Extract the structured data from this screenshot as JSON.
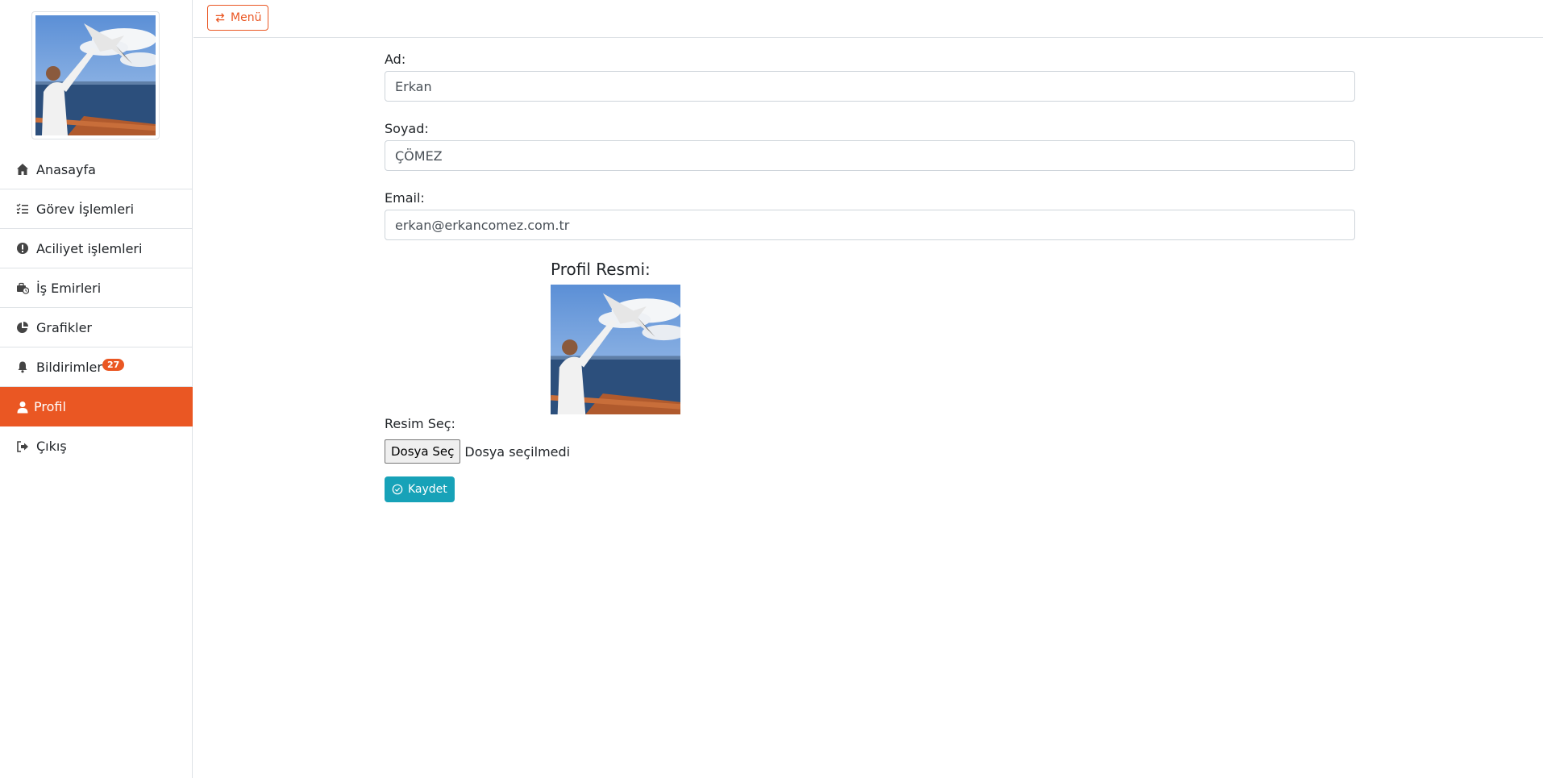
{
  "sidebar": {
    "avatar_alt": "profile photo",
    "items": [
      {
        "label": "Anasayfa",
        "icon": "home-icon"
      },
      {
        "label": "Görev İşlemleri",
        "icon": "task-list-icon"
      },
      {
        "label": "Aciliyet işlemleri",
        "icon": "exclamation-circle-icon"
      },
      {
        "label": "İş Emirleri",
        "icon": "briefcase-clock-icon"
      },
      {
        "label": "Grafikler",
        "icon": "pie-chart-icon"
      },
      {
        "label": "Bildirimler",
        "icon": "bell-icon",
        "badge": "27"
      },
      {
        "label": "Profil",
        "icon": "user-icon",
        "active": true
      },
      {
        "label": "Çıkış",
        "icon": "sign-out-icon"
      }
    ]
  },
  "topbar": {
    "menu_label": "Menü",
    "menu_icon": "exchange-arrows-icon"
  },
  "form": {
    "first_name_label": "Ad:",
    "first_name_value": "Erkan",
    "last_name_label": "Soyad:",
    "last_name_value": "ÇÖMEZ",
    "email_label": "Email:",
    "email_value": "erkan@erkancomez.com.tr",
    "profile_picture_label": "Profil Resmi:",
    "choose_image_label": "Resim Seç:",
    "file_button_label": "Dosya Seç",
    "file_status": "Dosya seçilmedi",
    "save_label": "Kaydet",
    "save_icon": "check-circle-icon"
  },
  "colors": {
    "accent": "#ea5723",
    "save_button": "#17a2b8",
    "border": "#dee2e6"
  }
}
